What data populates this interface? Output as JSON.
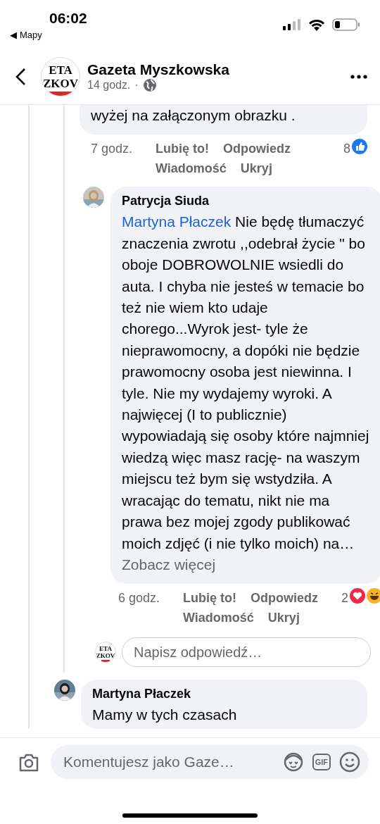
{
  "status_bar": {
    "time": "06:02",
    "back_arrow": "◀",
    "back_app": "Mapy"
  },
  "header": {
    "logo_lines": [
      "ETA",
      "ZKOV"
    ],
    "title": "Gazeta Myszkowska",
    "time": "14 godz.",
    "separator": "·"
  },
  "comments": [
    {
      "text": "wyżej na załączonym obrazku .",
      "time": "7 godz.",
      "actions": [
        "Lubię to!",
        "Odpowiedz",
        "Wiadomość",
        "Ukryj"
      ],
      "reaction_count": "8",
      "reactions": [
        {
          "kind": "like"
        }
      ]
    },
    {
      "author": "Patrycja Siuda",
      "mention": "Martyna Płaczek",
      "text": "Nie będę tłumaczyć znaczenia zwrotu ,,odebrał życie \" bo oboje DOBROWOLNIE wsiedli do auta. I chyba nie jesteś w temacie bo też nie wiem kto udaje chorego...Wyrok jest- tyle że nieprawomocny, a dopóki nie będzie prawomocny osoba jest niewinna. I tyle. Nie my wydajemy wyroki. A najwięcej (I to publicznie) wypowiadają się osoby które najmniej wiedzą więc masz rację- na waszym miejscu też bym się wstydziła. A wracając do tematu, nikt nie ma prawa bez mojej zgody publikować moich zdjęć (i nie tylko moich) na…",
      "see_more": "Zobacz więcej",
      "time": "6 godz.",
      "actions": [
        "Lubię to!",
        "Odpowiedz",
        "Wiadomość",
        "Ukryj"
      ],
      "reaction_count": "2",
      "reactions": [
        {
          "kind": "love"
        },
        {
          "kind": "haha"
        }
      ]
    }
  ],
  "reply_box": {
    "logo_lines": [
      "ETA",
      "ZKOV"
    ],
    "placeholder": "Napisz odpowiedź…"
  },
  "next_comment": {
    "author": "Martyna Płaczek",
    "text": "Mamy w tych czasach"
  },
  "composer": {
    "placeholder": "Komentujesz jako Gaze…",
    "gif_label": "GIF"
  }
}
